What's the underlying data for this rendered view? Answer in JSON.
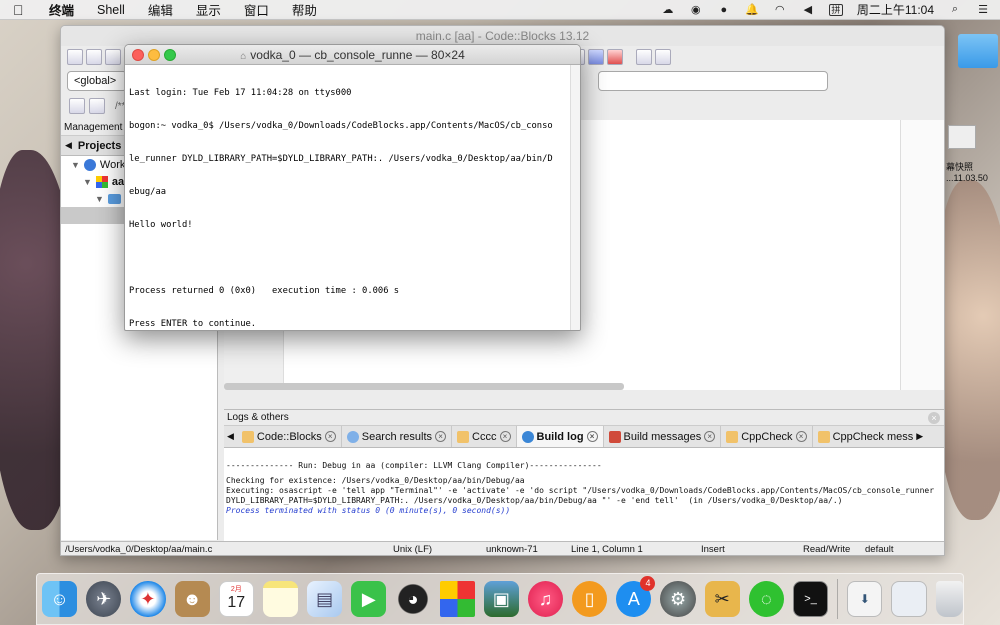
{
  "menubar": {
    "items": [
      "终端",
      "Shell",
      "编辑",
      "显示",
      "窗口",
      "帮助"
    ],
    "clock": "周二上午11:04",
    "input_method": "拼"
  },
  "codeblocks": {
    "title": "main.c [aa] - Code::Blocks 13.12",
    "scope_combo": "<global>",
    "comment_field": "/**",
    "management_label": "Management",
    "projects_tab": "Projects",
    "tree": [
      "Work",
      "aa"
    ],
    "logs_label": "Logs & others",
    "log_tabs": [
      "Code::Blocks",
      "Search results",
      "Cccc",
      "Build log",
      "Build messages",
      "CppCheck",
      "CppCheck mess"
    ],
    "log_lines": [
      "-------------- Run: Debug in aa (compiler: LLVM Clang Compiler)---------------",
      "",
      "Checking for existence: /Users/vodka_0/Desktop/aa/bin/Debug/aa",
      "Executing: osascript -e 'tell app \"Terminal\"' -e 'activate' -e 'do script \"/Users/vodka_0/Downloads/CodeBlocks.app/Contents/MacOS/cb_console_runner",
      "DYLD_LIBRARY_PATH=$DYLD_LIBRARY_PATH:. /Users/vodka_0/Desktop/aa/bin/Debug/aa \"' -e 'end tell'  (in /Users/vodka_0/Desktop/aa/.)"
    ],
    "log_final": "Process terminated with status 0 (0 minute(s), 0 second(s))",
    "status": {
      "path": "/Users/vodka_0/Desktop/aa/main.c",
      "eol": "Unix (LF)",
      "encoding": "unknown-71",
      "position": "Line 1, Column 1",
      "mode": "Insert",
      "rw": "Read/Write",
      "profile": "default"
    }
  },
  "terminal": {
    "title": "vodka_0 — cb_console_runne — 80×24",
    "lines": [
      "Last login: Tue Feb 17 11:04:28 on ttys000",
      "bogon:~ vodka_0$ /Users/vodka_0/Downloads/CodeBlocks.app/Contents/MacOS/cb_conso",
      "le_runner DYLD_LIBRARY_PATH=$DYLD_LIBRARY_PATH:. /Users/vodka_0/Desktop/aa/bin/D",
      "ebug/aa",
      "Hello world!",
      "",
      "Process returned 0 (0x0)   execution time : 0.006 s",
      "Press ENTER to continue."
    ]
  },
  "desktop": {
    "screenshot_label_1": "幕快照",
    "screenshot_label_2": "...11.03.50"
  },
  "dock": {
    "calendar_month": "2月",
    "calendar_day": "17",
    "appstore_badge": "4"
  }
}
